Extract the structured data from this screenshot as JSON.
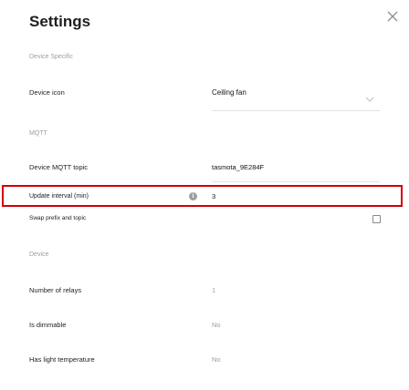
{
  "header": {
    "title": "Settings"
  },
  "sections": {
    "device_specific": "Device Specific",
    "mqtt": "MQTT",
    "device": "Device"
  },
  "fields": {
    "device_icon": {
      "label": "Device icon",
      "value": "Ceiling fan"
    },
    "mqtt_topic": {
      "label": "Device MQTT topic",
      "value": "tasmota_9E284F"
    },
    "update_interval": {
      "label": "Update interval (min)",
      "value": "3"
    },
    "swap_prefix": {
      "label": "Swap prefix and topic"
    },
    "number_of_relays": {
      "label": "Number of relays",
      "value": "1"
    },
    "is_dimmable": {
      "label": "Is dimmable",
      "value": "No"
    },
    "has_light_temperature": {
      "label": "Has light temperature",
      "value": "No"
    }
  },
  "icons": {
    "close": "close-icon",
    "dropdown": "chevron-down-icon",
    "info": "info-icon"
  }
}
